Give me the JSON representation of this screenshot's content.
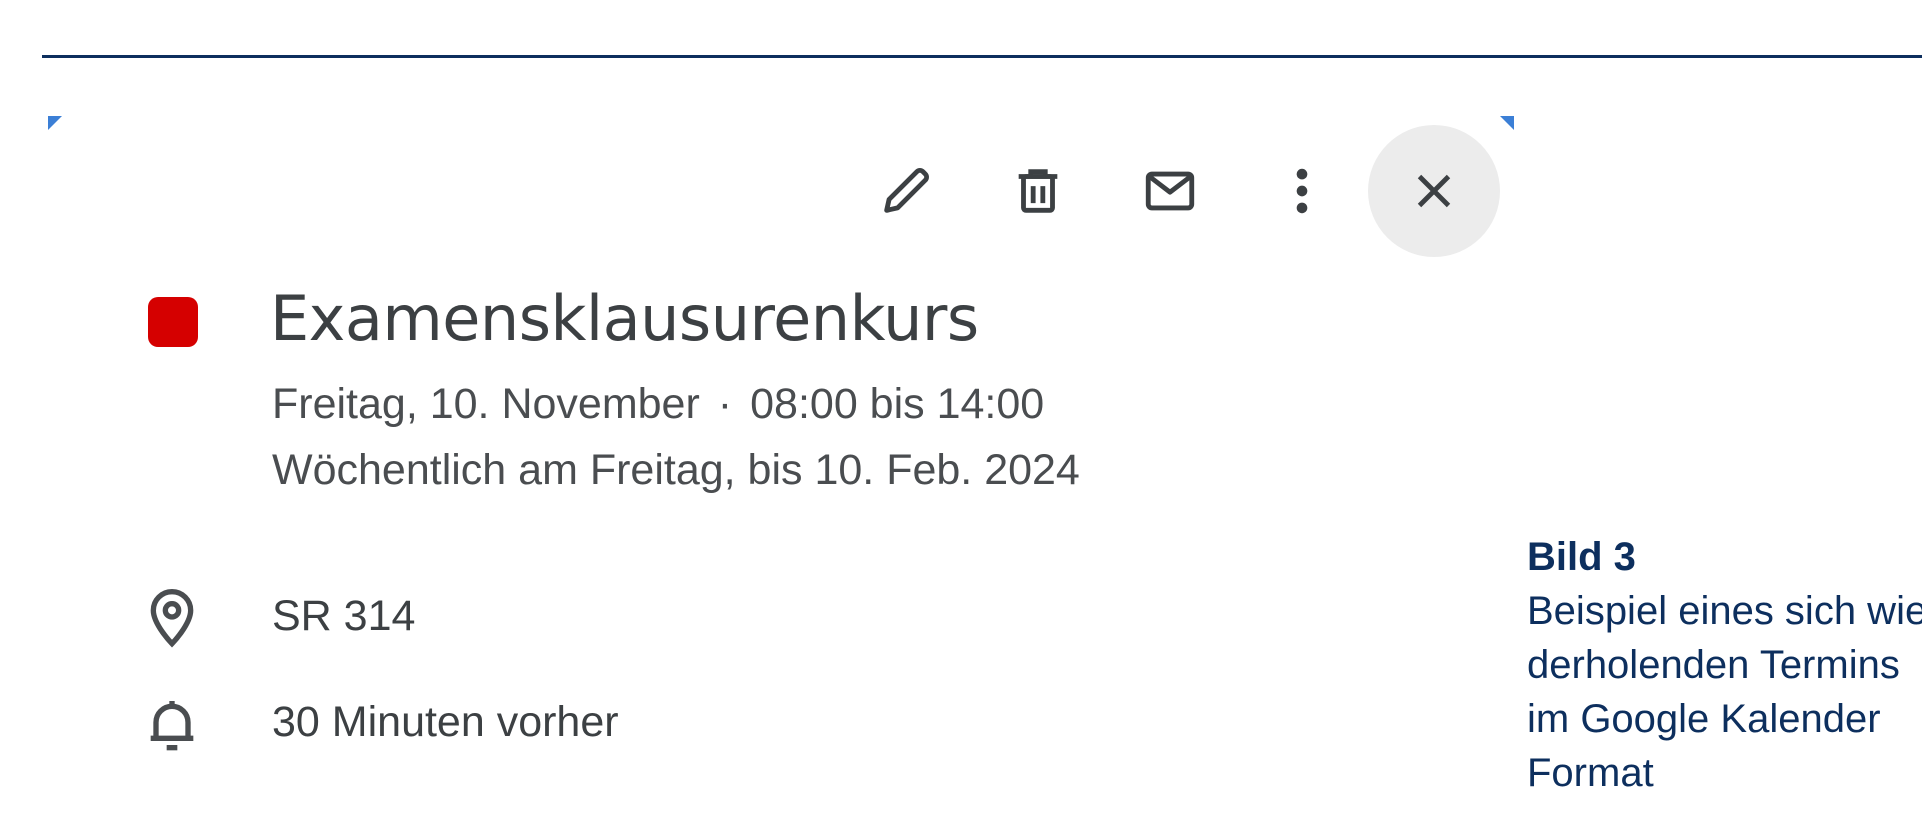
{
  "toolbar": {
    "buttons": [
      {
        "name": "edit",
        "icon": "pencil-icon"
      },
      {
        "name": "delete",
        "icon": "trash-icon"
      },
      {
        "name": "email",
        "icon": "mail-icon"
      },
      {
        "name": "more",
        "icon": "more-vert-icon"
      },
      {
        "name": "close",
        "icon": "close-icon"
      }
    ]
  },
  "event": {
    "color": "#d50000",
    "title": "Examensklausurenkurs",
    "date": "Freitag, 10. November",
    "separator": "·",
    "time": "08:00 bis 14:00",
    "recurrence": "Wöchentlich am Freitag, bis 10. Feb. 2024",
    "location": "SR 314",
    "notification": "30 Minuten vorher"
  },
  "caption": {
    "title": "Bild 3",
    "lines": [
      "Beispiel eines sich wie-",
      "derholenden Termins",
      "im Google Kalender",
      "Format"
    ]
  },
  "colors": {
    "accent": "#0d2f5e",
    "event_color": "#d50000",
    "corner_marks": "#3b7fd6"
  }
}
